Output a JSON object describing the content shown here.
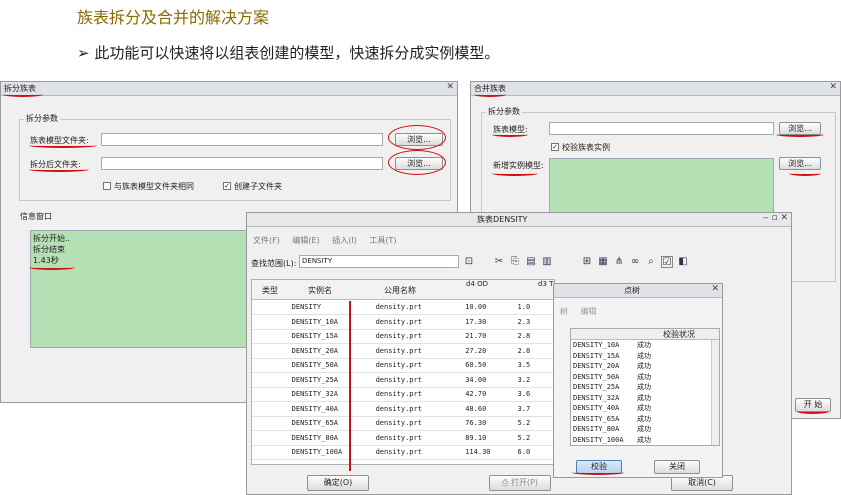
{
  "slide": {
    "title": "族表拆分及合并的解决方案",
    "bullet_marker": "➢",
    "bullet": "此功能可以快速将以组表创建的模型，快速拆分成实例模型。"
  },
  "split_dialog": {
    "title": "拆分族表",
    "group_label": "拆分参数",
    "family_folder_label": "族表模型文件夹:",
    "family_folder_value": "",
    "browse1": "浏览...",
    "output_folder_label": "拆分后文件夹:",
    "output_folder_value": "",
    "browse2": "浏览...",
    "same_folder_label": "与族表模型文件夹相同",
    "create_subfolder_label": "创建子文件夹",
    "info_label": "信息窗口",
    "info_lines": [
      "拆分开始..",
      "拆分结束",
      "1.43秒"
    ]
  },
  "merge_dialog": {
    "title": "合并族表",
    "group_label": "拆分参数",
    "family_model_label": "族表模型:",
    "browse1": "浏览...",
    "verify_label": "校验族表实例",
    "new_instance_label": "新增实例模型:",
    "browse2": "浏览...",
    "start_button": "开 始"
  },
  "table_dialog": {
    "title": "族表DENSITY",
    "menu": [
      "文件(F)",
      "编辑(E)",
      "插入(I)",
      "工具(T)"
    ],
    "scope_label": "查找范围(L):",
    "scope_value": "DENSITY",
    "columns": [
      "类型",
      "实例名",
      "公用名称",
      "d4 OD",
      "d3 THK"
    ],
    "rows": [
      [
        "",
        "DENSITY",
        "density.prt",
        "10.00",
        "1.0"
      ],
      [
        "",
        "DENSITY_10A",
        "density.prt",
        "17.30",
        "2.3"
      ],
      [
        "",
        "DENSITY_15A",
        "density.prt",
        "21.70",
        "2.8"
      ],
      [
        "",
        "DENSITY_20A",
        "density.prt",
        "27.20",
        "2.8"
      ],
      [
        "",
        "DENSITY_50A",
        "density.prt",
        "60.50",
        "3.5"
      ],
      [
        "",
        "DENSITY_25A",
        "density.prt",
        "34.00",
        "3.2"
      ],
      [
        "",
        "DENSITY_32A",
        "density.prt",
        "42.70",
        "3.6"
      ],
      [
        "",
        "DENSITY_40A",
        "density.prt",
        "48.60",
        "3.7"
      ],
      [
        "",
        "DENSITY_65A",
        "density.prt",
        "76.30",
        "5.2"
      ],
      [
        "",
        "DENSITY_80A",
        "density.prt",
        "89.10",
        "5.2"
      ],
      [
        "",
        "DENSITY_100A",
        "density.prt",
        "114.30",
        "6.0"
      ]
    ],
    "ok_button": "确定(O)",
    "open_button": "打开(P)",
    "cancel_button": "取消(C)"
  },
  "tree_dialog": {
    "title": "点树",
    "menu": [
      "树",
      "编辑"
    ],
    "column": "校验状况",
    "rows": [
      [
        "DENSITY_10A",
        "成功"
      ],
      [
        "DENSITY_15A",
        "成功"
      ],
      [
        "DENSITY_20A",
        "成功"
      ],
      [
        "DENSITY_50A",
        "成功"
      ],
      [
        "DENSITY_25A",
        "成功"
      ],
      [
        "DENSITY_32A",
        "成功"
      ],
      [
        "DENSITY_40A",
        "成功"
      ],
      [
        "DENSITY_65A",
        "成功"
      ],
      [
        "DENSITY_80A",
        "成功"
      ],
      [
        "DENSITY_100A",
        "成功"
      ]
    ],
    "verify_button": "校验",
    "close_button": "关闭"
  },
  "colors": {
    "info_green": "#b4e0b4",
    "annotation_red": "#d01010",
    "title_gold": "#8a6a00"
  }
}
